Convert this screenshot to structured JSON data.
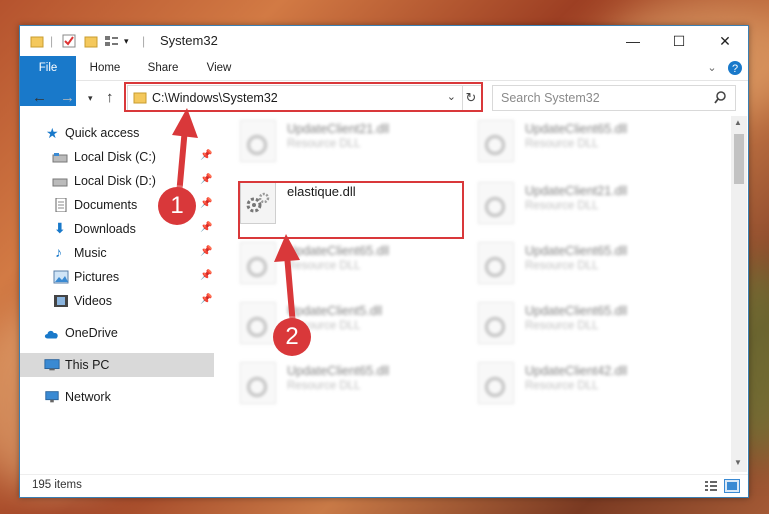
{
  "window": {
    "title": "System32",
    "controls": {
      "minimize": "—",
      "maximize": "☐",
      "close": "✕"
    }
  },
  "ribbon": {
    "tabs": [
      {
        "label": "File"
      },
      {
        "label": "Home"
      },
      {
        "label": "Share"
      },
      {
        "label": "View"
      }
    ]
  },
  "address": {
    "path": "C:\\Windows\\System32"
  },
  "search": {
    "placeholder": "Search System32"
  },
  "sidebar": {
    "items": [
      {
        "label": "Quick access"
      },
      {
        "label": "Local Disk (C:)"
      },
      {
        "label": "Local Disk (D:)"
      },
      {
        "label": "Documents"
      },
      {
        "label": "Downloads"
      },
      {
        "label": "Music"
      },
      {
        "label": "Pictures"
      },
      {
        "label": "Videos"
      },
      {
        "label": "OneDrive"
      },
      {
        "label": "This PC"
      },
      {
        "label": "Network"
      }
    ]
  },
  "files": [
    {
      "name": "UpdateClient21.dll",
      "type": "Resource DLL"
    },
    {
      "name": "UpdateClient65.dll",
      "type": "Resource DLL"
    },
    {
      "name": "elastique.dll",
      "type": ""
    },
    {
      "name": "UpdateClient21.dll",
      "type": "Resource DLL"
    },
    {
      "name": "UpdateClient65.dll",
      "type": "Resource DLL"
    },
    {
      "name": "UpdateClient65.dll",
      "type": "Resource DLL"
    },
    {
      "name": "UpdateClient5.dll",
      "type": "Resource DLL"
    },
    {
      "name": "UpdateClient65.dll",
      "type": "Resource DLL"
    },
    {
      "name": "UpdateClient65.dll",
      "type": "Resource DLL"
    },
    {
      "name": "UpdateClient42.dll",
      "type": "Resource DLL"
    }
  ],
  "status": {
    "item_count": "195 items"
  },
  "annotations": {
    "step1": "1",
    "step2": "2",
    "color": "#d9383a"
  }
}
